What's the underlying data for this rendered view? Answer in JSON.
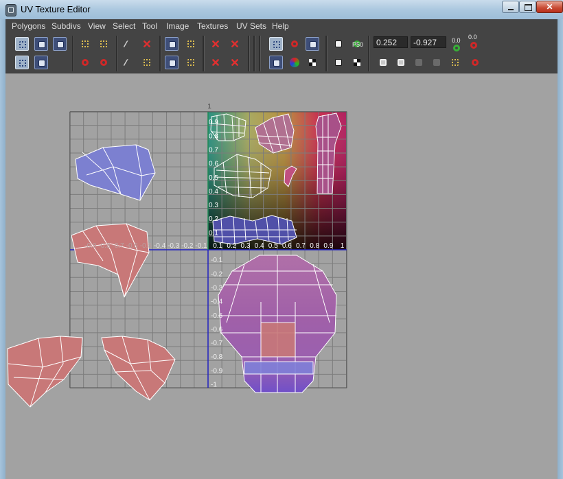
{
  "window": {
    "title": "UV Texture Editor",
    "close_glyph": "✕",
    "icons": [
      "app-icon",
      "minimize-icon",
      "maximize-icon",
      "close-icon"
    ]
  },
  "menu": {
    "items": [
      "Polygons",
      "Subdivs",
      "View",
      "Select",
      "Tool",
      "Image",
      "Textures",
      "UV Sets",
      "Help"
    ]
  },
  "toolbar": {
    "u_value": "0.252",
    "v_value": "-0.927",
    "small_labels": {
      "rotate_up_a": "0.0",
      "rotate_up_b": "0.0",
      "pixel_snap": "P50"
    },
    "icons": [
      "uv-select-icon",
      "uv-move-icon",
      "uv-paint-icon",
      "uv-lattice-icon",
      "uv-smudge-icon",
      "flip-u-icon",
      "flip-v-icon",
      "rotate-ccw-icon",
      "rotate-cw-icon",
      "cut-uv-icon",
      "sew-uv-icon",
      "split-icon",
      "merge-icon",
      "layout-icon",
      "unfold-icon",
      "relax-icon",
      "align-icon",
      "grid-uv-icon",
      "magnet-icon",
      "image-display-icon",
      "texture-borders-icon",
      "rgb-channels-icon",
      "checker-icon",
      "dim-image-icon",
      "isolate-icon",
      "shade-uvs-icon",
      "copy-uv-icon",
      "paste-uv-icon",
      "paste-u-icon",
      "paste-v-icon",
      "cycle-uv-icon",
      "delete-uv-icon"
    ]
  },
  "uv_editor": {
    "axis_origin_label": "1",
    "u_tick_labels_positive": [
      "0.1",
      "0.2",
      "0.3",
      "0.4",
      "0.5",
      "0.6",
      "0.7",
      "0.8",
      "0.9",
      "1"
    ],
    "u_tick_labels_negative": [
      "-0.4",
      "-0.3",
      "-0.2",
      "-0.1"
    ],
    "u_tick_labels_negative_faint": [
      "-0.9",
      "-0.8",
      "-0.7",
      "-0.6",
      "-0.5"
    ],
    "v_tick_labels_positive": [
      "0.9",
      "0.8",
      "0.7",
      "0.6",
      "0.5",
      "0.4",
      "0.3",
      "0.2",
      "0.1"
    ],
    "v_tick_labels_negative": [
      "-0.1",
      "-0.2",
      "-0.3",
      "-0.4",
      "-0.5",
      "-0.6",
      "-0.7",
      "-0.8",
      "-0.9",
      "-1"
    ],
    "colors": {
      "grid_line": "#7c7c7c",
      "axis_line": "#2020c0",
      "uv_edge": "#ffffff",
      "unselected_shell": "#c87878",
      "blue_shell": "#7c80d0",
      "head_shell": "#a060a8"
    }
  }
}
